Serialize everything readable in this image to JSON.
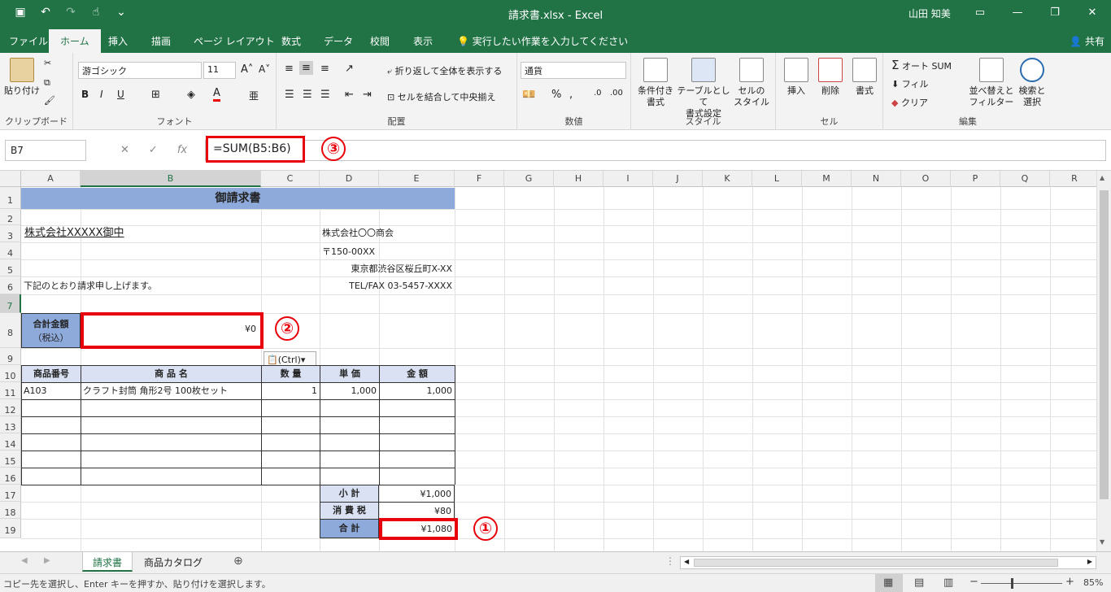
{
  "titlebar": {
    "title": "請求書.xlsx  -  Excel",
    "user": "山田 知美"
  },
  "tabs": [
    "ファイル",
    "ホーム",
    "挿入",
    "描画",
    "ページ レイアウト",
    "数式",
    "データ",
    "校閲",
    "表示"
  ],
  "tell_me": "実行したい作業を入力してください",
  "share": "共有",
  "ribbon": {
    "clipboard": {
      "paste": "貼り付け",
      "label": "クリップボード"
    },
    "font": {
      "name": "游ゴシック",
      "size": "11",
      "label": "フォント"
    },
    "align": {
      "wrap": "折り返して全体を表示する",
      "merge": "セルを結合して中央揃え",
      "label": "配置"
    },
    "number": {
      "format": "通貨",
      "label": "数値"
    },
    "styles": {
      "cond1": "条件付き",
      "cond2": "書式",
      "table1": "テーブルとして",
      "table2": "書式設定",
      "cell1": "セルの",
      "cell2": "スタイル",
      "label": "スタイル"
    },
    "cells": {
      "insert": "挿入",
      "delete": "削除",
      "format": "書式",
      "label": "セル"
    },
    "edit": {
      "autosum": "オート SUM",
      "fill": "フィル",
      "clear": "クリア",
      "sort1": "並べ替えと",
      "sort2": "フィルター",
      "find1": "検索と",
      "find2": "選択",
      "label": "編集"
    }
  },
  "formula_bar": {
    "namebox": "B7",
    "formula": "=SUM(B5:B6)"
  },
  "columns": [
    "A",
    "B",
    "C",
    "D",
    "E",
    "F",
    "G",
    "H",
    "I",
    "J",
    "K",
    "L",
    "M",
    "N",
    "O",
    "P",
    "Q",
    "R"
  ],
  "rows": [
    "1",
    "2",
    "3",
    "4",
    "5",
    "6",
    "7",
    "8",
    "9",
    "10",
    "11",
    "12",
    "13",
    "14",
    "15",
    "16",
    "17",
    "18",
    "19"
  ],
  "sheet": {
    "title": "御請求書",
    "client": "株式会社XXXXX御中",
    "company": "株式会社〇〇商会",
    "zip": "〒150-00XX",
    "address": "東京都渋谷区桜丘町X-XX",
    "tel": "TEL/FAX 03-5457-XXXX",
    "note": "下記のとおり請求申し上げます。",
    "total_label1": "合計金額",
    "total_label2": "（税込）",
    "total_value": "¥0",
    "paste_ctrl": "(Ctrl)",
    "headers": [
      "商品番号",
      "商 品 名",
      "数 量",
      "単 価",
      "金 額"
    ],
    "item": {
      "code": "A103",
      "name": "クラフト封筒 角形2号 100枚セット",
      "qty": "1",
      "price": "1,000",
      "amount": "1,000"
    },
    "subtotal_label": "小 計",
    "subtotal": "¥1,000",
    "tax_label": "消 費 税",
    "tax": "¥80",
    "sum_label": "合 計",
    "sum": "¥1,080"
  },
  "callouts": [
    "①",
    "②",
    "③"
  ],
  "sheet_tabs": [
    "請求書",
    "商品カタログ"
  ],
  "status": {
    "message": "コピー先を選択し、Enter キーを押すか、貼り付けを選択します。",
    "zoom": "85%"
  },
  "colors": {
    "excel_green": "#217346",
    "header_fill": "#d9e1f2",
    "title_fill": "#8eaadb",
    "callout_red": "#e8000a"
  }
}
